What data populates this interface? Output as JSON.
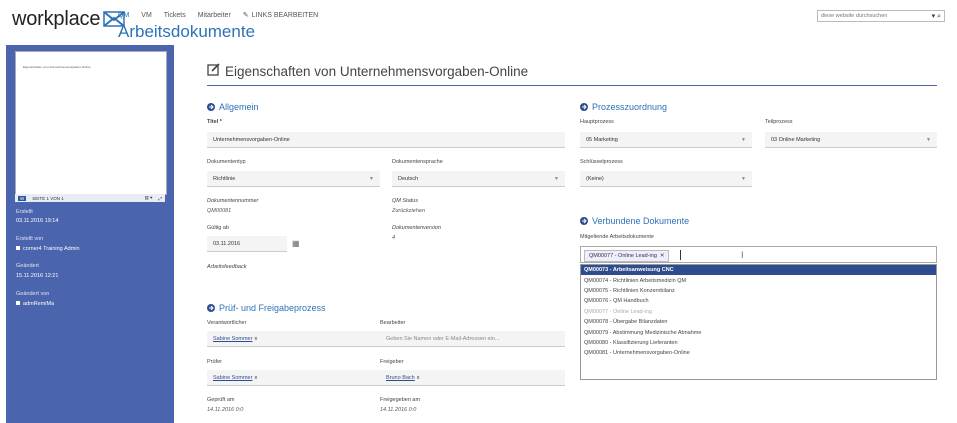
{
  "header": {
    "logo": "workplace",
    "nav": [
      "QM",
      "VM",
      "Tickets",
      "Mitarbeiter"
    ],
    "edit_links": "LINKS BEARBEITEN",
    "page_title": "Arbeitsdokumente",
    "search_placeholder": "diese website durchsuchen"
  },
  "sidebar": {
    "preview_text": "Eigenschaften von Unternehmensvorgaben-Online",
    "page_indicator": "SEITE 1 VON 1",
    "created_label": "Erstellt",
    "created_value": "03.11.2016 19:14",
    "created_by_label": "Erstellt von",
    "created_by_value": "corner4 Training Admin",
    "changed_label": "Geändert",
    "changed_value": "15.11.2016 12:21",
    "changed_by_label": "Geändert von",
    "changed_by_value": "admRemiMa"
  },
  "main": {
    "section_title": "Eigenschaften von Unternehmensvorgaben-Online",
    "allgemein": {
      "heading": "Allgemein",
      "titel_label": "Titel *",
      "titel_value": "Unternehmensvorgaben-Online",
      "doktyp_label": "Dokumententyp",
      "doktyp_value": "Richtlinie",
      "dokspr_label": "Dokumentensprache",
      "dokspr_value": "Deutsch",
      "doknr_label": "Dokumentennummer",
      "doknr_value": "QM00081",
      "status_label": "QM Status",
      "status_value": "Zurückziehen",
      "gueltig_label": "Gültig ab",
      "gueltig_value": "03.11.2016",
      "version_label": "Dokumentenversion",
      "version_value": "4",
      "feedback_label": "Arbeitsfeedback"
    },
    "prozess": {
      "heading": "Prozesszuordnung",
      "haupt_label": "Hauptprozess",
      "haupt_value": "05 Marketing",
      "teil_label": "Teilprozess",
      "teil_value": "03 Online Marketing",
      "schluessel_label": "Schlüsselprozess",
      "schluessel_value": "(Keine)"
    },
    "verbunden": {
      "heading": "Verbundene Dokumente",
      "mitgeltend_label": "Mitgeltende Arbeitsdokumente",
      "token": "QM00077 - Online Lead-ing",
      "options": [
        "QM00073 - Arbeitsanweisung CNC",
        "QM00074 - Richtlinien Arbeitsmedizin QM",
        "QM00075 - Richtlinien Konzernbilanz",
        "QM00076 - QM Handbuch",
        "QM00077 - Online Lead-ing",
        "QM00078 - Übergabe Bilanzdaten",
        "QM00079 - Abstimmung Medizinische Abnahme",
        "QM00080 - Klassifizierung Lieferanten",
        "QM00081 - Unternehmensvorgaben-Online"
      ]
    },
    "pruef": {
      "heading": "Prüf- und Freigabeprozess",
      "verantw_label": "Verantwortlicher",
      "verantw_value": "Sabine Sommer",
      "bearbeiter_label": "Bearbeiter",
      "bearbeiter_placeholder": "Geben Sie Namen oder E-Mail-Adressen ein...",
      "pruefer_label": "Prüfer",
      "pruefer_value": "Sabine Sommer",
      "freigeber_label": "Freigeber",
      "freigeber_value": "Bruno Bach",
      "geprueft_label": "Geprüft am",
      "geprueft_value": "14.11.2016 0:0",
      "freigegeben_label": "Freigegeben am",
      "freigegeben_value": "14.11.2016 0:0"
    }
  },
  "colors": {
    "accent": "#2e72b8",
    "sidebar": "#4a64ad",
    "selected": "#2e4d8f"
  }
}
